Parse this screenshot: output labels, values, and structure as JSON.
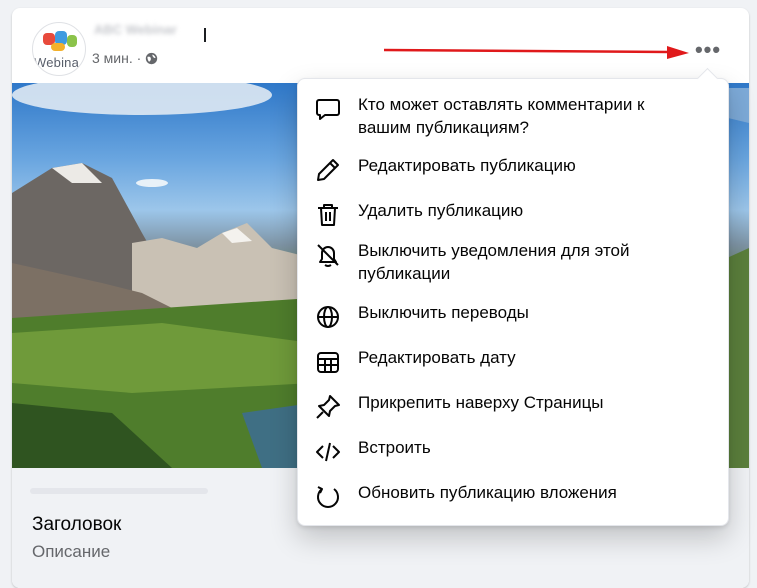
{
  "post": {
    "avatar_text": "Webina",
    "page_name": "ABC Webinar",
    "timestamp": "3 мин. ·",
    "privacy_icon": "globe-icon",
    "more_icon": "more-horizontal-icon"
  },
  "link_preview": {
    "title": "Заголовок",
    "description": "Описание"
  },
  "menu": {
    "items": [
      {
        "label": "Кто может оставлять комментарии к вашим публикациям?",
        "icon": "comment-icon"
      },
      {
        "label": "Редактировать публикацию",
        "icon": "pencil-icon"
      },
      {
        "label": "Удалить публикацию",
        "icon": "trash-icon"
      },
      {
        "label": "Выключить уведомления для этой публикации",
        "icon": "bell-off-icon"
      },
      {
        "label": "Выключить переводы",
        "icon": "globe-translate-icon"
      },
      {
        "label": "Редактировать дату",
        "icon": "calendar-icon"
      },
      {
        "label": "Прикрепить наверху Страницы",
        "icon": "pin-icon"
      },
      {
        "label": "Встроить",
        "icon": "code-icon"
      },
      {
        "label": "Обновить публикацию вложения",
        "icon": "refresh-icon"
      }
    ]
  },
  "colors": {
    "annotation_arrow": "#e0191b",
    "text_primary": "#050505",
    "text_secondary": "#65676b"
  }
}
